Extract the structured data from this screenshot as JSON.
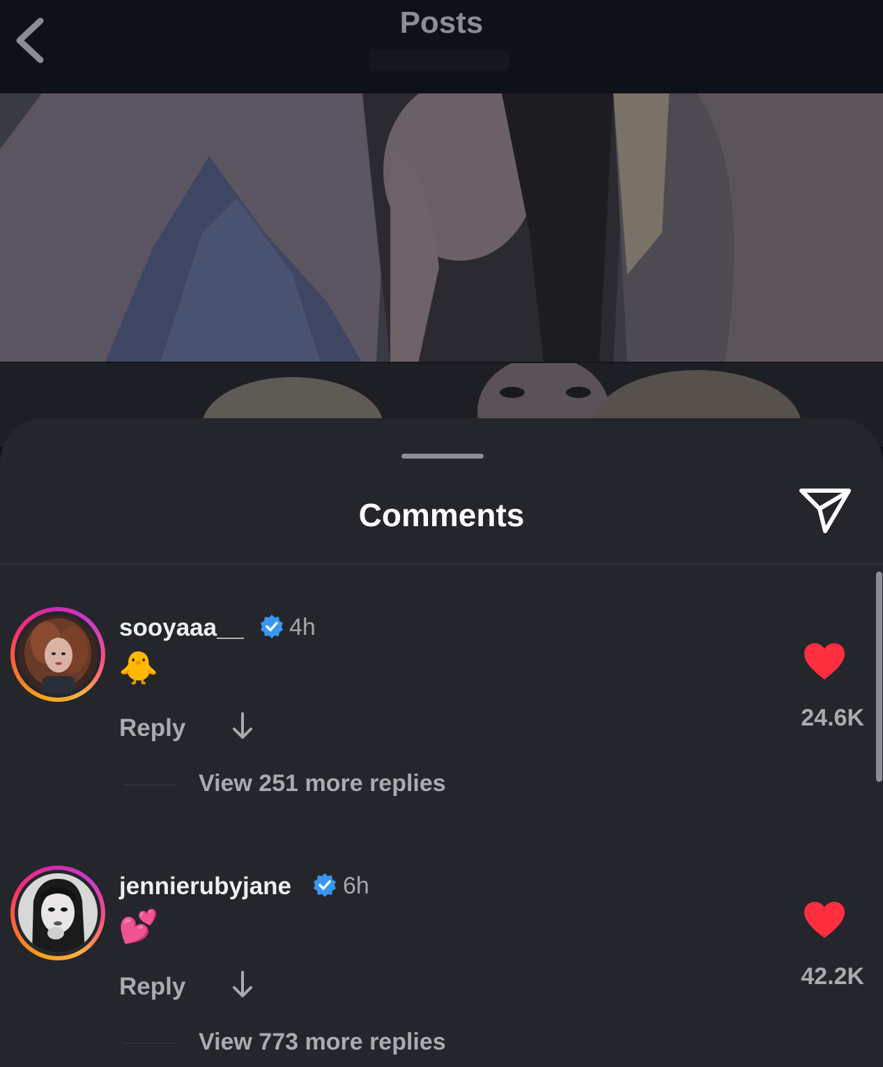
{
  "header": {
    "title": "Posts",
    "back_icon": "chevron-left-icon"
  },
  "sheet": {
    "title": "Comments",
    "share_icon": "paper-plane-icon"
  },
  "comments": [
    {
      "username": "sooyaa​a__",
      "verified": true,
      "time": "4h",
      "text": "🐥",
      "reply_label": "Reply",
      "like_count": "24.6K",
      "liked": true,
      "view_replies": "View 251 more replies"
    },
    {
      "username": "jennierubyjane",
      "verified": true,
      "time": "6h",
      "text": "💕",
      "reply_label": "Reply",
      "like_count": "42.2K",
      "liked": true,
      "view_replies": "View 773 more replies"
    }
  ],
  "colors": {
    "sheet_bg": "#24262c",
    "like_red": "#ff2f40",
    "verified_blue": "#3897f0"
  }
}
